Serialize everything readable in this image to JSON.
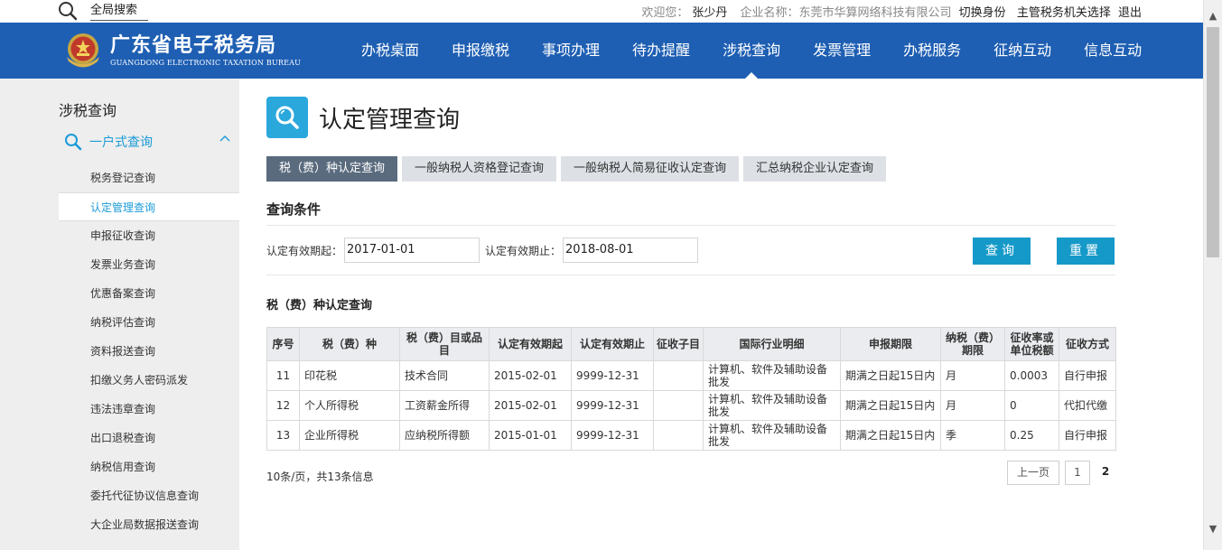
{
  "topbar": {
    "search_label": "全局搜索",
    "welcome_label": "欢迎您：",
    "user_name": "张少丹",
    "company_label": "企业名称：",
    "company_name": "东莞市华算网络科技有限公司",
    "switch_identity": "切换身份",
    "tax_office_select": "主管税务机关选择",
    "logout": "退出"
  },
  "header": {
    "logo_cn": "广东省电子税务局",
    "logo_en": "GUANGDONG ELECTRONIC TAXATION BUREAU",
    "brand_color": "#1e5fb3",
    "nav": [
      {
        "label": "办税桌面"
      },
      {
        "label": "申报缴税"
      },
      {
        "label": "事项办理"
      },
      {
        "label": "待办提醒"
      },
      {
        "label": "涉税查询",
        "active": true
      },
      {
        "label": "发票管理"
      },
      {
        "label": "办税服务"
      },
      {
        "label": "征纳互动"
      },
      {
        "label": "信息互动"
      }
    ]
  },
  "sidebar": {
    "title": "涉税查询",
    "group_label": "一户式查询",
    "accent_color": "#1a9bd7",
    "items": [
      {
        "label": "税务登记查询"
      },
      {
        "label": "认定管理查询",
        "active": true
      },
      {
        "label": "申报征收查询"
      },
      {
        "label": "发票业务查询"
      },
      {
        "label": "优惠备案查询"
      },
      {
        "label": "纳税评估查询"
      },
      {
        "label": "资料报送查询"
      },
      {
        "label": "扣缴义务人密码派发"
      },
      {
        "label": "违法违章查询"
      },
      {
        "label": "出口退税查询"
      },
      {
        "label": "纳税信用查询"
      },
      {
        "label": "委托代征协议信息查询"
      },
      {
        "label": "大企业局数据报送查询"
      }
    ]
  },
  "main": {
    "page_title": "认定管理查询",
    "tabs": [
      {
        "label": "税（费）种认定查询",
        "active": true
      },
      {
        "label": "一般纳税人资格登记查询"
      },
      {
        "label": "一般纳税人简易征收认定查询"
      },
      {
        "label": "汇总纳税企业认定查询"
      }
    ],
    "query_section_title": "查询条件",
    "filters": {
      "start_label": "认定有效期起：",
      "start_value": "2017-01-01",
      "end_label": "认定有效期止：",
      "end_value": "2018-08-01"
    },
    "query_button": "查询",
    "reset_button": "重置",
    "result_title": "税（费）种认定查询",
    "table": {
      "columns": [
        "序号",
        "税（费）种",
        "税（费）目或品目",
        "认定有效期起",
        "认定有效期止",
        "征收子目",
        "国际行业明细",
        "申报期限",
        "纳税（费）期限",
        "征收率或单位税额",
        "征收方式"
      ],
      "rows": [
        [
          "11",
          "印花税",
          "技术合同",
          "2015-02-01",
          "9999-12-31",
          "",
          "计算机、软件及辅助设备批发",
          "期满之日起15日内",
          "月",
          "0.0003",
          "自行申报"
        ],
        [
          "12",
          "个人所得税",
          "工资薪金所得",
          "2015-02-01",
          "9999-12-31",
          "",
          "计算机、软件及辅助设备批发",
          "期满之日起15日内",
          "月",
          "0",
          "代扣代缴"
        ],
        [
          "13",
          "企业所得税",
          "应纳税所得额",
          "2015-01-01",
          "9999-12-31",
          "",
          "计算机、软件及辅助设备批发",
          "期满之日起15日内",
          "季",
          "0.25",
          "自行申报"
        ]
      ]
    },
    "pager": {
      "info": "10条/页，共13条信息",
      "prev": "上一页",
      "page1": "1",
      "current": "2"
    }
  }
}
